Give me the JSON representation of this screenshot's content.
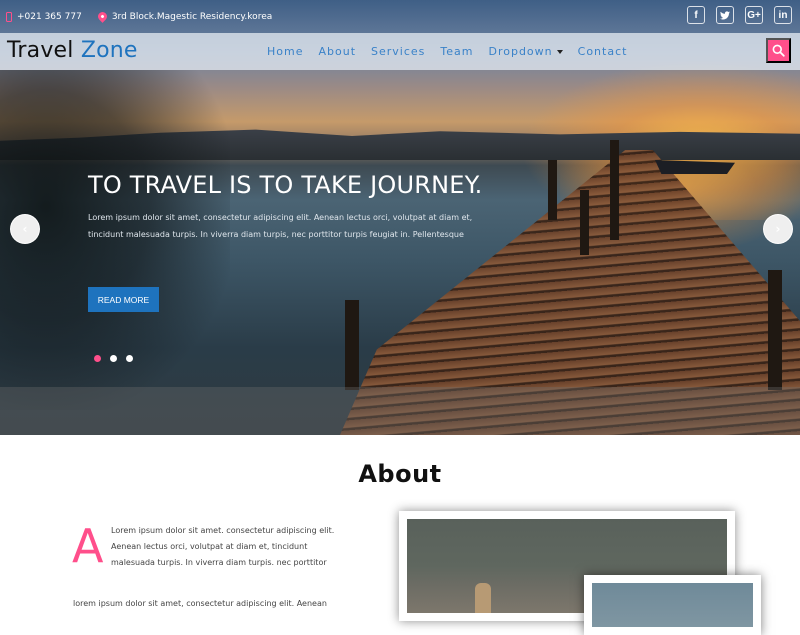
{
  "topbar": {
    "phone": "+021 365 777",
    "address": "3rd Block.Magestic Residency.korea",
    "social": [
      {
        "icon": "facebook-icon",
        "glyph": "f"
      },
      {
        "icon": "twitter-icon",
        "glyph": "t"
      },
      {
        "icon": "google-plus-icon",
        "glyph": "G+"
      },
      {
        "icon": "linkedin-icon",
        "glyph": "in"
      }
    ]
  },
  "navbar": {
    "logo_part1": "Travel",
    "logo_part2": "Zone",
    "items": [
      "Home",
      "About",
      "Services",
      "Team",
      "Dropdown",
      "Contact"
    ],
    "search_icon": "search-icon"
  },
  "hero": {
    "title": "TO TRAVEL IS TO TAKE JOURNEY.",
    "text": "Lorem ipsum dolor sit amet, consectetur adipiscing elit. Aenean lectus orci, volutpat at diam et, tincidunt malesuada turpis. In viverra diam turpis, nec porttitor turpis feugiat in. Pellentesque",
    "button": "READ MORE",
    "prev_glyph": "‹",
    "next_glyph": "›",
    "slides_total": 3,
    "active_slide": 1
  },
  "about": {
    "title": "About",
    "dropcap": "A",
    "paragraph1": "Lorem ipsum dolor sit amet. consectetur adipiscing elit. Aenean lectus orci, volutpat at diam et, tincidunt malesuada turpis. In viverra diam turpis. nec porttitor",
    "paragraph2": "lorem ipsum dolor sit amet, consectetur adipiscing elit. Aenean"
  },
  "colors": {
    "accent_pink": "#ff4f8b",
    "brand_blue": "#1e73be",
    "nav_link": "#3a82c8"
  }
}
